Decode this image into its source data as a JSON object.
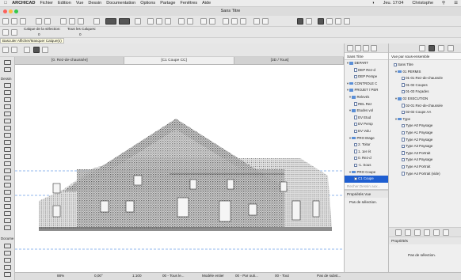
{
  "menubar": {
    "app": "ARCHICAD",
    "items": [
      "Fichier",
      "Edition",
      "Vue",
      "Dessin",
      "Documentation",
      "Options",
      "Partage",
      "Fenêtres",
      "Aide"
    ],
    "clock": "Jeu. 17:04",
    "user": "Christophe"
  },
  "window": {
    "title": "Sans Titre"
  },
  "toolbar": {
    "layer_label": "Calque de la sélection:",
    "layer_all_label": "Tous les Calques:",
    "layer_value": "0",
    "layer_all_value": "0",
    "tooltip": "Basculer Afficher/Masquer Calque(s)"
  },
  "toolbox": {
    "section_design": "Dessin",
    "section_doc": "Docume"
  },
  "tabs": [
    {
      "label": "[0. Rez-de-chaussée]"
    },
    {
      "label": "[C1 Coupe CC]"
    },
    {
      "label": "[3D / Tous]"
    }
  ],
  "status": {
    "zoom": "88%",
    "angle": "0,00°",
    "scale": "1:100",
    "layers": "00 - Tous le...",
    "model": "Modèle entier",
    "override": "00 - Par outi...",
    "pen": "00 - Tout",
    "renovation": "Pas de subst..."
  },
  "navigator1": {
    "top_label": "Sans Titre",
    "items": [
      {
        "label": "DEPART",
        "level": 0,
        "kind": "folder"
      },
      {
        "label": "DEP Rez-d",
        "level": 2,
        "kind": "doc"
      },
      {
        "label": "DEP Perspe",
        "level": 2,
        "kind": "doc"
      },
      {
        "label": "CONTROLE C",
        "level": 0,
        "kind": "folder"
      },
      {
        "label": "PROJET / PER",
        "level": 0,
        "kind": "folder"
      },
      {
        "label": "Relevés",
        "level": 1,
        "kind": "folder"
      },
      {
        "label": "REL Rez",
        "level": 2,
        "kind": "doc"
      },
      {
        "label": "Etudes vol",
        "level": 1,
        "kind": "folder"
      },
      {
        "label": "EV Etud",
        "level": 2,
        "kind": "doc"
      },
      {
        "label": "EV Persp",
        "level": 2,
        "kind": "doc"
      },
      {
        "label": "EV Volu",
        "level": 2,
        "kind": "doc"
      },
      {
        "label": "PRO Etage",
        "level": 1,
        "kind": "folder"
      },
      {
        "label": "2. Toitur",
        "level": 2,
        "kind": "doc"
      },
      {
        "label": "1. 1er ét",
        "level": 2,
        "kind": "doc"
      },
      {
        "label": "0. Rez-d",
        "level": 2,
        "kind": "doc"
      },
      {
        "label": "-1. Sous",
        "level": 2,
        "kind": "doc"
      },
      {
        "label": "PRO Coupe",
        "level": 1,
        "kind": "folder"
      },
      {
        "label": "C1 Coupe",
        "level": 2,
        "kind": "doc",
        "selected": true
      }
    ],
    "search_placeholder": "Recher.Dessin aux...",
    "props_title": "Propriétés Vue",
    "props_text": "Pas de sélection."
  },
  "navigator2": {
    "top_label": "Vue par sous-ensemble",
    "items": [
      {
        "label": "Sans Titre",
        "level": 0,
        "kind": "doc"
      },
      {
        "label": "01 PERMIS",
        "level": 1,
        "kind": "folder"
      },
      {
        "label": "01-01 Rez-de-chaussée",
        "level": 2,
        "kind": "doc"
      },
      {
        "label": "01-02 Coupes",
        "level": 2,
        "kind": "doc"
      },
      {
        "label": "01-03 Façades",
        "level": 2,
        "kind": "doc"
      },
      {
        "label": "02 EXECUTION",
        "level": 1,
        "kind": "folder"
      },
      {
        "label": "02-01 Rez-de-chaussée",
        "level": 2,
        "kind": "doc"
      },
      {
        "label": "02-02 Coupe AA",
        "level": 2,
        "kind": "doc"
      },
      {
        "label": "Type",
        "level": 1,
        "kind": "folder"
      },
      {
        "label": "Type A0 Paysage",
        "level": 2,
        "kind": "doc"
      },
      {
        "label": "Type A1 Paysage",
        "level": 2,
        "kind": "doc"
      },
      {
        "label": "Type A2 Paysage",
        "level": 2,
        "kind": "doc"
      },
      {
        "label": "Type A3 Paysage",
        "level": 2,
        "kind": "doc"
      },
      {
        "label": "Type A3 Portrait",
        "level": 2,
        "kind": "doc"
      },
      {
        "label": "Type A4 Paysage",
        "level": 2,
        "kind": "doc"
      },
      {
        "label": "Type A4 Portrait",
        "level": 2,
        "kind": "doc"
      },
      {
        "label": "Type A4 Portrait (vide)",
        "level": 2,
        "kind": "doc"
      }
    ],
    "props_title": "Propriétés",
    "props_text": "Pas de sélection."
  }
}
